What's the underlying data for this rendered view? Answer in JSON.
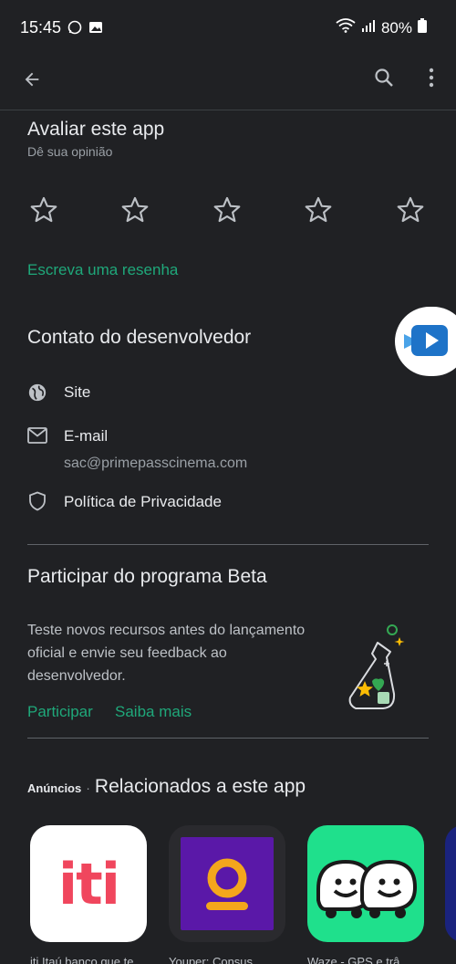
{
  "status_bar": {
    "time": "15:45",
    "battery": "80%"
  },
  "rating": {
    "title": "Avaliar este app",
    "subtitle": "Dê sua opinião",
    "stars": 5,
    "write_review": "Escreva uma resenha"
  },
  "developer": {
    "title": "Contato do desenvolvedor",
    "site_label": "Site",
    "email_label": "E-mail",
    "email_value": "sac@primepasscinema.com",
    "privacy_label": "Política de Privacidade"
  },
  "beta": {
    "title": "Participar do programa Beta",
    "line1": "Teste novos recursos antes do lançamento",
    "line2": "oficial e envie seu feedback ao",
    "line3": "desenvolvedor.",
    "join": "Participar",
    "learn_more": "Saiba mais"
  },
  "related": {
    "ads_label": "Anúncios",
    "title": "Relacionados a este app",
    "apps": [
      {
        "logo_text": "iti",
        "name": "iti Itaú banco que te..."
      },
      {
        "name": "Youper: Consus..."
      },
      {
        "name": "Waze - GPS e trâ..."
      }
    ]
  },
  "colors": {
    "background": "#202124",
    "accent_green": "#1fa87a",
    "divider": "#5f6368"
  }
}
